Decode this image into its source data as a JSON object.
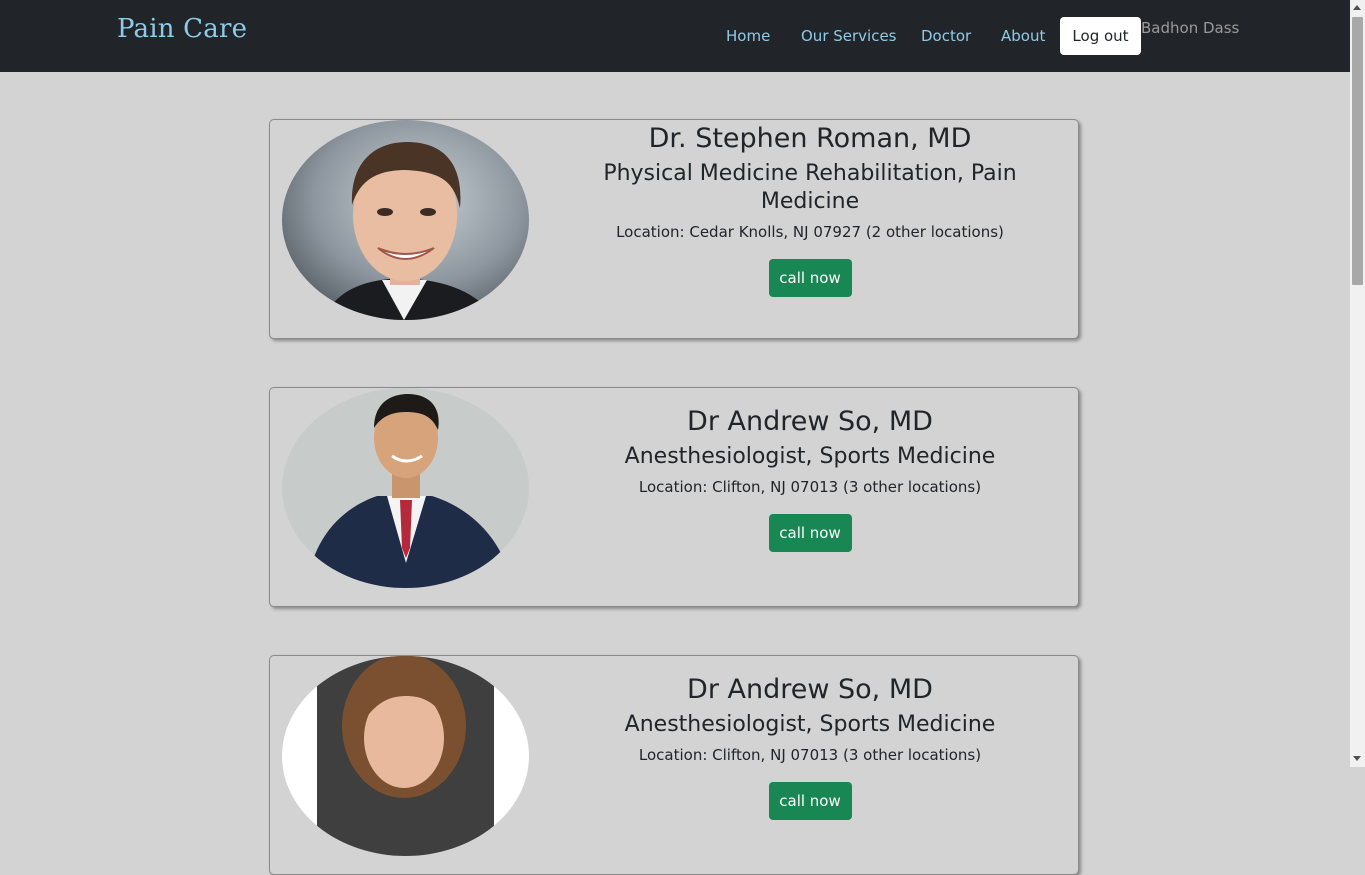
{
  "nav": {
    "brand": "Pain Care",
    "links": [
      "Home",
      "Our Services",
      "Doctor",
      "About"
    ],
    "logout_label": "Log out",
    "username": "Badhon Dass"
  },
  "doctors": [
    {
      "name": "Dr. Stephen Roman, MD",
      "specialty": "Physical Medicine Rehabilitation, Pain Medicine",
      "location": "Location: Cedar Knolls, NJ 07927 (2 other locations)",
      "button": "call now"
    },
    {
      "name": "Dr Andrew So, MD",
      "specialty": "Anesthesiologist, Sports Medicine",
      "location": "Location: Clifton, NJ 07013 (3 other locations)",
      "button": "call now"
    },
    {
      "name": "Dr Andrew So, MD",
      "specialty": "Anesthesiologist, Sports Medicine",
      "location": "Location: Clifton, NJ 07013 (3 other locations)",
      "button": "call now"
    }
  ],
  "colors": {
    "navbar": "#212529",
    "page_background": "#d3d3d3",
    "link": "#8ecbe8",
    "call_button": "#198754"
  }
}
